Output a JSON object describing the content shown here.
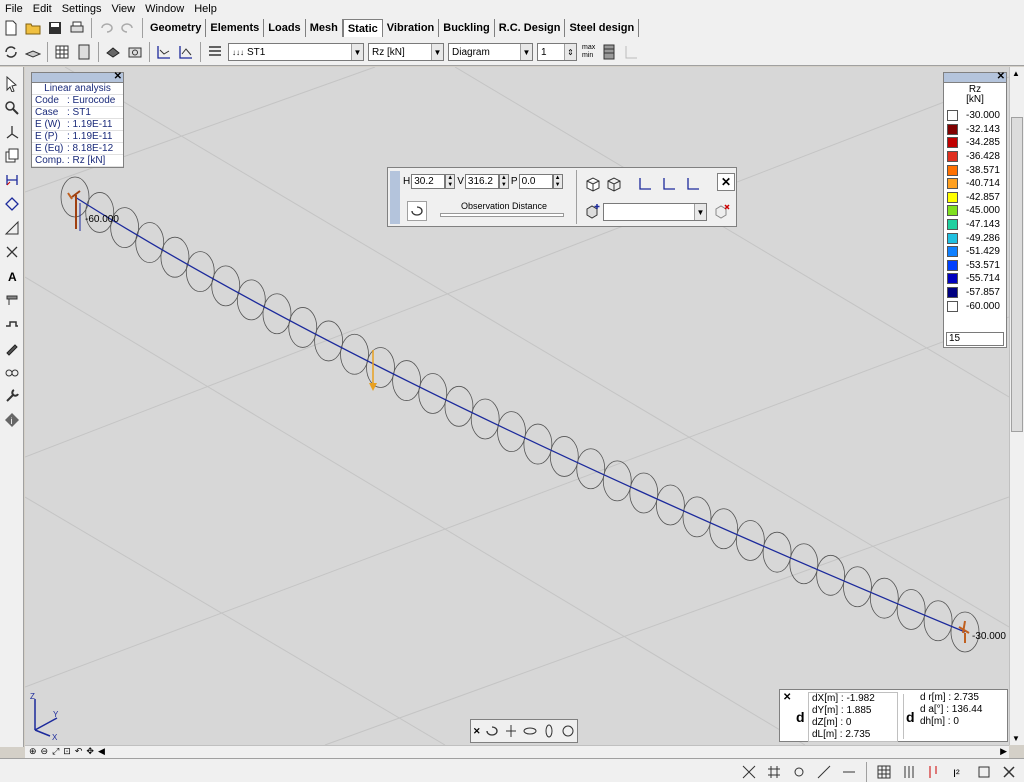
{
  "menu": [
    "File",
    "Edit",
    "Settings",
    "View",
    "Window",
    "Help"
  ],
  "module_tabs": [
    "Geometry",
    "Elements",
    "Loads",
    "Mesh",
    "Static",
    "Vibration",
    "Buckling",
    "R.C. Design",
    "Steel design"
  ],
  "active_tab": "Static",
  "toolbar2": {
    "load_case": "ST1",
    "component": "Rz [kN]",
    "display_mode": "Diagram",
    "count": "1",
    "max_label": "max",
    "min_label": "min"
  },
  "info_panel": {
    "title": "Linear analysis",
    "rows": [
      {
        "key": "Code",
        "value": ": Eurocode"
      },
      {
        "key": "Case",
        "value": ": ST1"
      },
      {
        "key": "E (W)",
        "value": ": 1.19E-11"
      },
      {
        "key": "E (P)",
        "value": ": 1.19E-11"
      },
      {
        "key": "E (Eq)",
        "value": ": 8.18E-12"
      },
      {
        "key": "Comp.",
        "value": ": Rz [kN]"
      }
    ]
  },
  "observation": {
    "h_label": "H",
    "h_value": "30.2",
    "v_label": "V",
    "v_value": "316.2",
    "p_label": "P",
    "p_value": "0.0",
    "distance_label": "Observation Distance"
  },
  "legend": {
    "title": "Rz",
    "unit": "[kN]",
    "entries": [
      {
        "value": "-30.000",
        "color": "#ffffff"
      },
      {
        "value": "-32.143",
        "color": "#800000"
      },
      {
        "value": "-34.285",
        "color": "#c00000"
      },
      {
        "value": "-36.428",
        "color": "#e03020"
      },
      {
        "value": "-38.571",
        "color": "#ff7000"
      },
      {
        "value": "-40.714",
        "color": "#ffa020"
      },
      {
        "value": "-42.857",
        "color": "#ffff00"
      },
      {
        "value": "-45.000",
        "color": "#80e020"
      },
      {
        "value": "-47.143",
        "color": "#20d0a0"
      },
      {
        "value": "-49.286",
        "color": "#20c0e0"
      },
      {
        "value": "-51.429",
        "color": "#1080ff"
      },
      {
        "value": "-53.571",
        "color": "#0040ff"
      },
      {
        "value": "-55.714",
        "color": "#0000c0"
      },
      {
        "value": "-57.857",
        "color": "#000080"
      },
      {
        "value": "-60.000",
        "color": "#ffffff"
      }
    ],
    "levels": "15"
  },
  "scene": {
    "label_start": "-60.000",
    "label_end": "-30.000",
    "beam_color": "#1c2a9c",
    "load_color": "#e8a020"
  },
  "coords": {
    "dx": "dX[m] : -1.982",
    "dy": "dY[m] : 1.885",
    "dz": "dZ[m] : 0",
    "dl": "dL[m] : 2.735",
    "dr": "d r[m] : 2.735",
    "da": "d a[°] : 136.44",
    "dh": "dh[m] : 0",
    "d_label": "d"
  },
  "axes": {
    "x": "X",
    "y": "Y",
    "z": "Z"
  }
}
